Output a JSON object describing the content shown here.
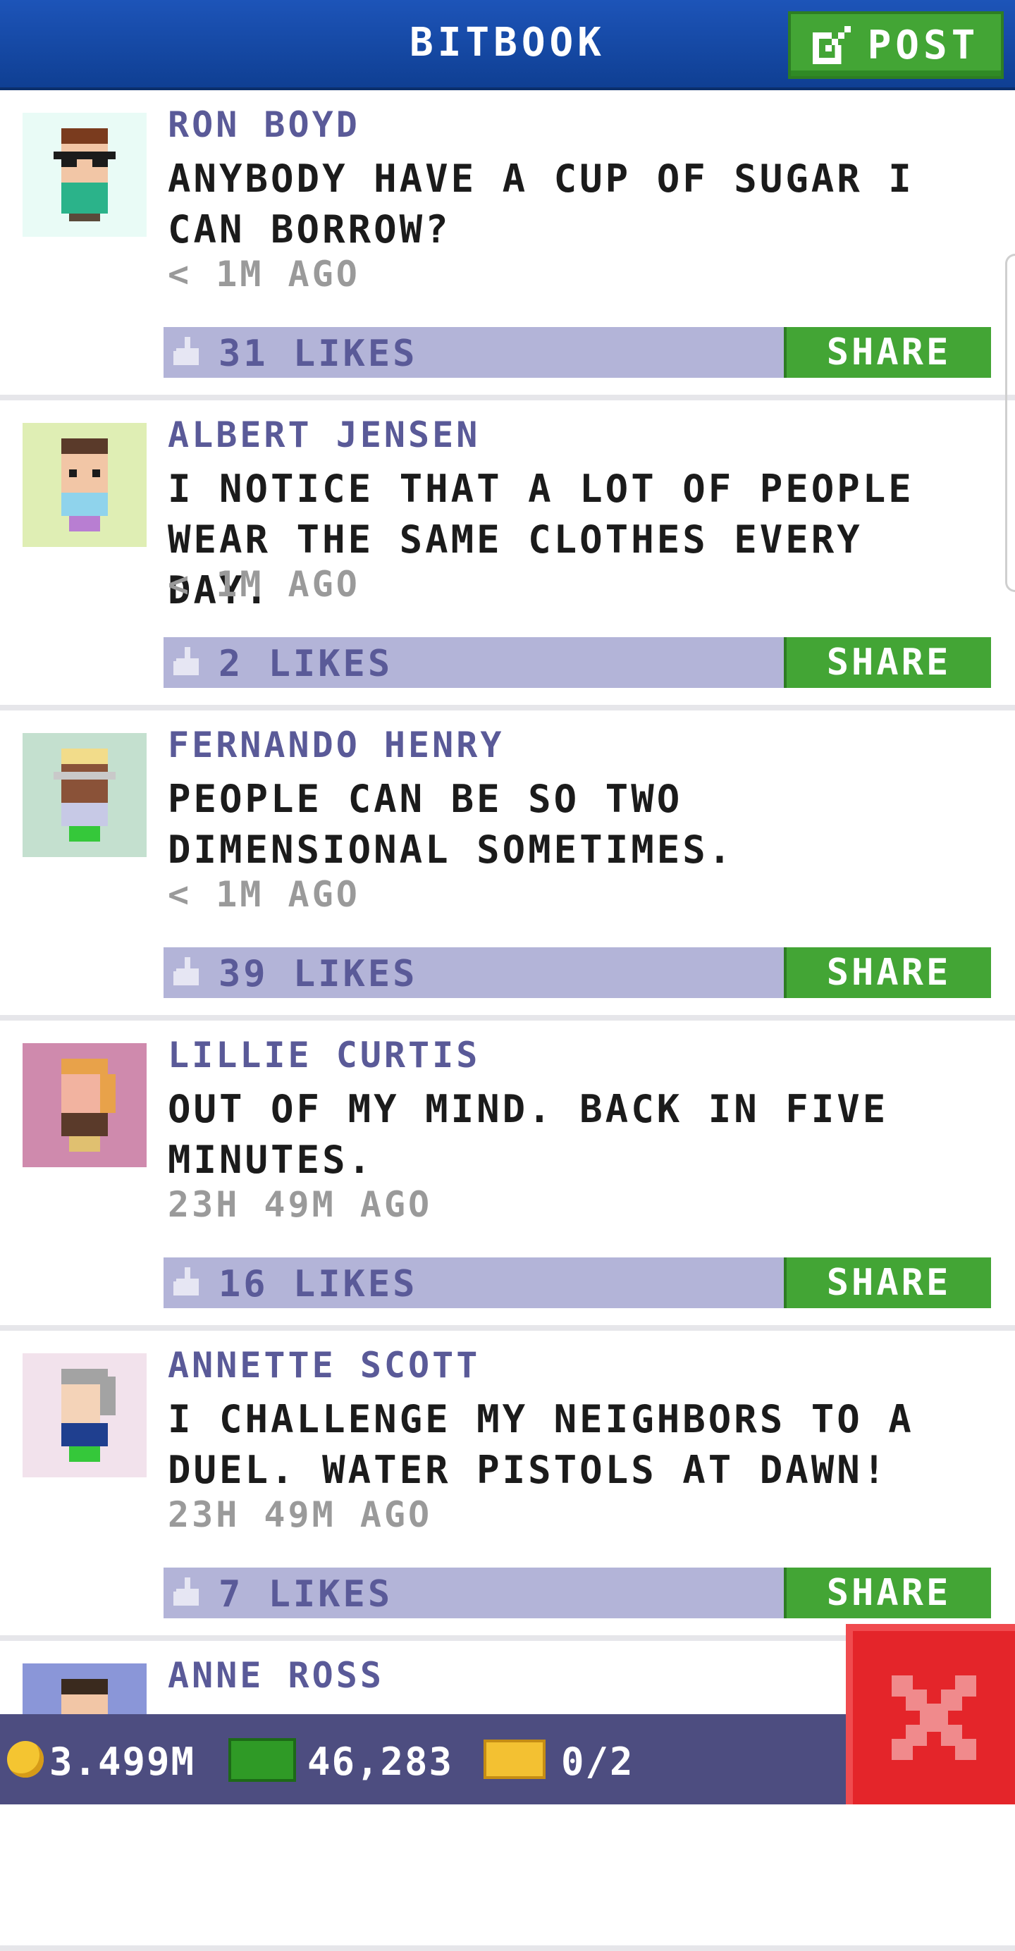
{
  "header": {
    "title": "BITBOOK",
    "post_label": "POST"
  },
  "posts": [
    {
      "author": "RON BOYD",
      "message": "ANYBODY HAVE A CUP OF SUGAR I CAN BORROW?",
      "time": "< 1M AGO",
      "likes": "31 LIKES",
      "share": "SHARE"
    },
    {
      "author": "ALBERT JENSEN",
      "message": "I NOTICE THAT A LOT OF PEOPLE WEAR THE SAME CLOTHES EVERY DAY.",
      "time": "< 1M AGO",
      "likes": "2 LIKES",
      "share": "SHARE"
    },
    {
      "author": "FERNANDO HENRY",
      "message": "PEOPLE CAN BE SO TWO DIMENSIONAL SOMETIMES.",
      "time": "< 1M AGO",
      "likes": "39 LIKES",
      "share": "SHARE"
    },
    {
      "author": "LILLIE CURTIS",
      "message": "OUT OF MY MIND. BACK IN FIVE MINUTES.",
      "time": "23H 49M AGO",
      "likes": "16 LIKES",
      "share": "SHARE"
    },
    {
      "author": "ANNETTE SCOTT",
      "message": "I CHALLENGE MY NEIGHBORS TO A DUEL. WATER PISTOLS AT DAWN!",
      "time": "23H 49M AGO",
      "likes": "7 LIKES",
      "share": "SHARE"
    },
    {
      "author": "ANNE ROSS"
    }
  ],
  "status": {
    "coins": "3.499M",
    "cash": "46,283",
    "tickets": "0/2"
  },
  "colors": {
    "header_blue": "#1d54b8",
    "accent_green": "#43a535",
    "like_bar": "#b3b4d8",
    "name_purple": "#5a5a98",
    "close_red": "#e4252a"
  }
}
